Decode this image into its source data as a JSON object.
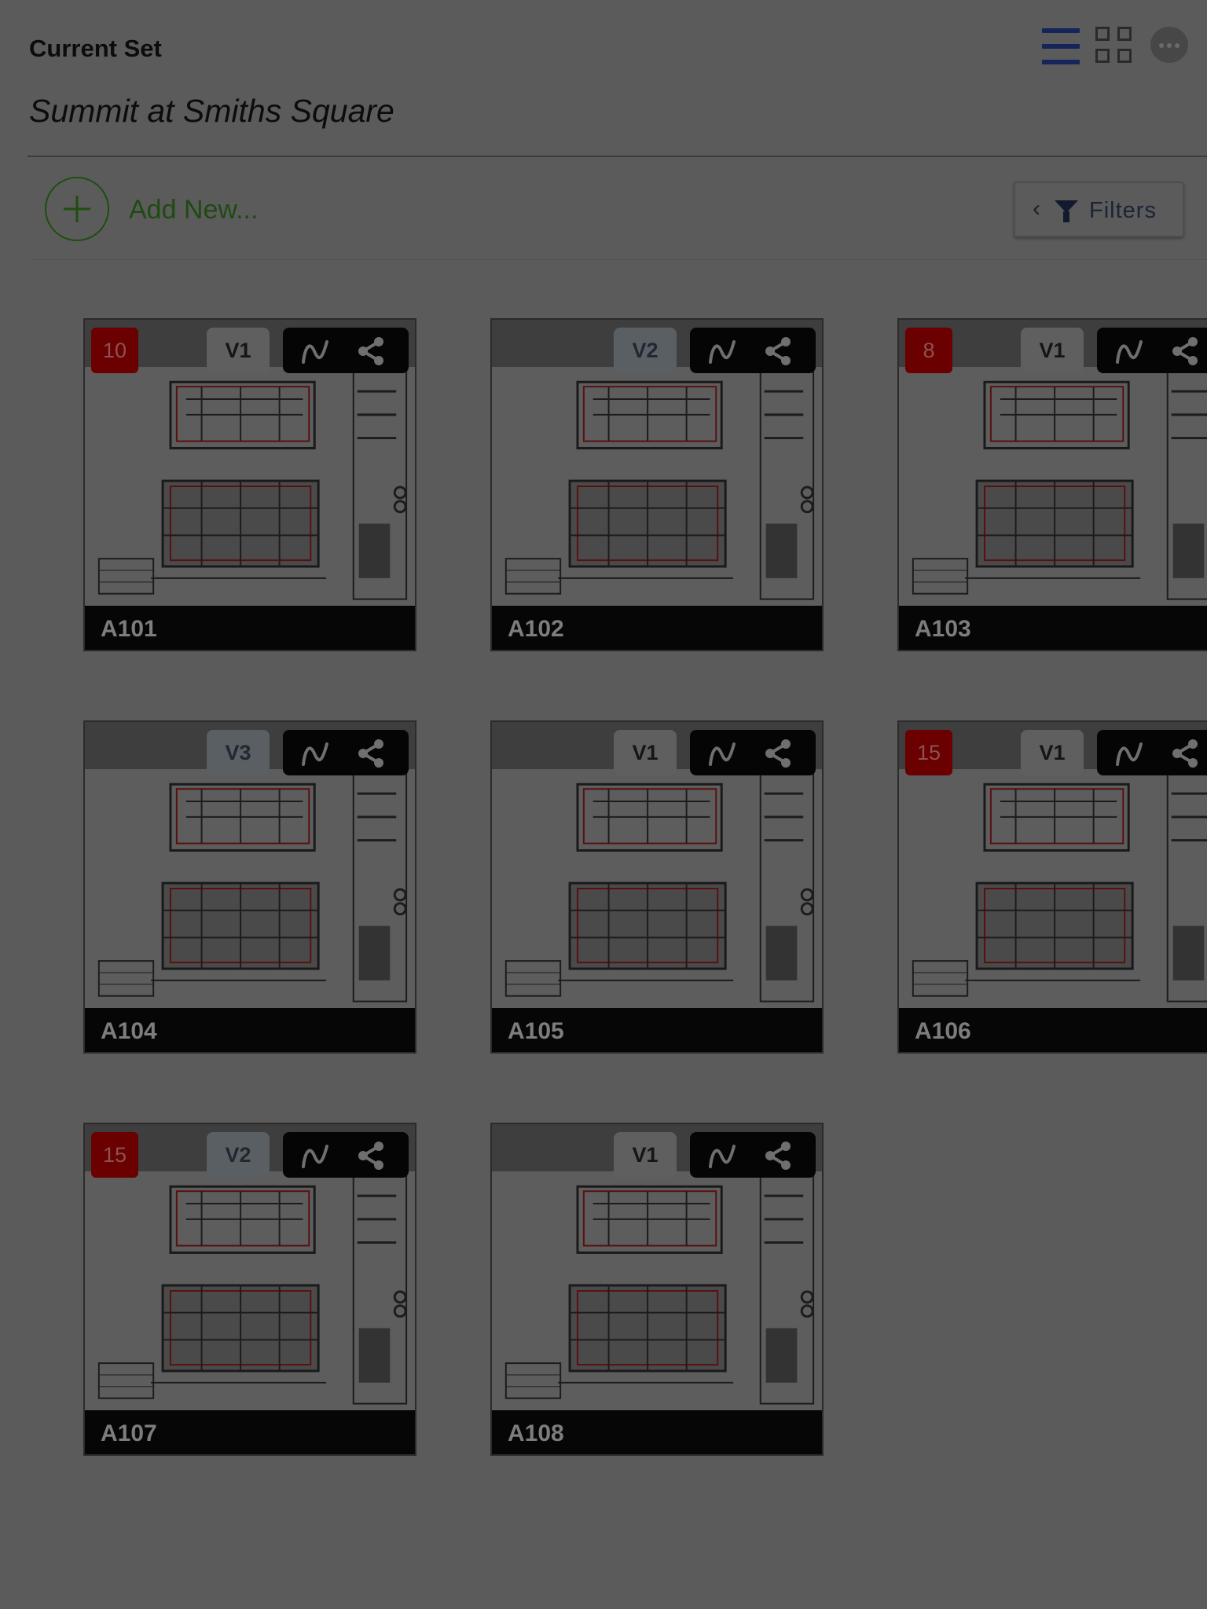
{
  "header": {
    "subtitle": "Current Set",
    "title": "Summit at Smiths Square"
  },
  "toolbar": {
    "add_label": "Add New...",
    "filters_label": "Filters"
  },
  "view_icons": [
    "list-view-icon",
    "grid-view-icon",
    "more-options-icon"
  ],
  "sheets": [
    {
      "name": "A101",
      "version": "V1",
      "badge": "10"
    },
    {
      "name": "A102",
      "version": "V2",
      "badge": ""
    },
    {
      "name": "A103",
      "version": "V1",
      "badge": "8"
    },
    {
      "name": "A104",
      "version": "V3",
      "badge": ""
    },
    {
      "name": "A105",
      "version": "V1",
      "badge": ""
    },
    {
      "name": "A106",
      "version": "V1",
      "badge": "15"
    },
    {
      "name": "A107",
      "version": "V2",
      "badge": "15"
    },
    {
      "name": "A108",
      "version": "V1",
      "badge": ""
    }
  ],
  "colors": {
    "overlay_background": "#5b5b5b",
    "badge_red": "#6a0000",
    "add_green": "#1e4f0e",
    "list_icon_blue": "#15245a"
  }
}
